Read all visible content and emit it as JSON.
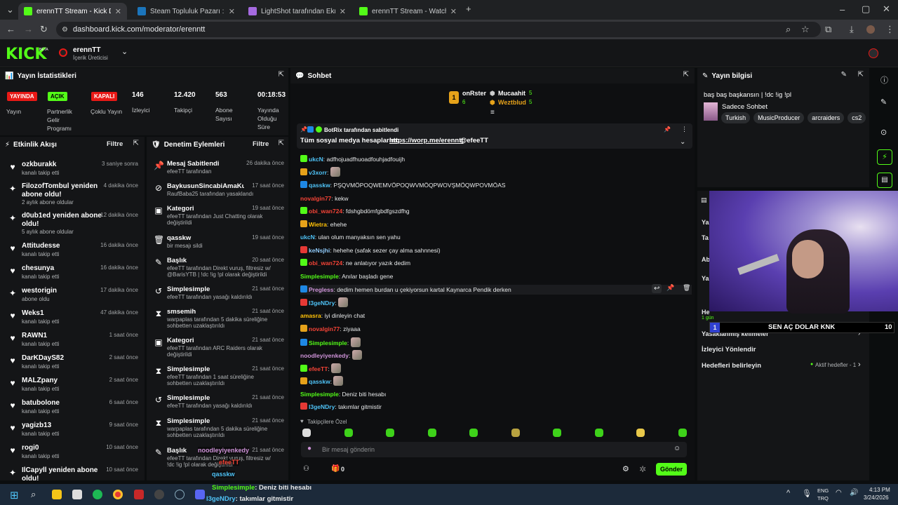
{
  "tabs": [
    {
      "title": "erennTT Stream - Kick Dashbo",
      "active": true,
      "color": "#53fc18"
    },
    {
      "title": "Steam Topluluk Pazarı :: Kul",
      "active": false,
      "color": "#1b75bb"
    },
    {
      "title": "LightShot tarafından Ekran Gö",
      "active": false,
      "color": "#a56ae0"
    },
    {
      "title": "erennTT Stream - Watch Live o",
      "active": false,
      "color": "#53fc18"
    }
  ],
  "url": "dashboard.kick.com/moderator/erenntt",
  "header": {
    "logo": "KICK",
    "beta": "BETA",
    "channel": "erennTT",
    "role": "İçerik Üreticisi"
  },
  "stats": {
    "title": "Yayın İstatistikleri",
    "badges": [
      {
        "badge": "YAYINDA",
        "label": "Yayın",
        "color": "#e91916"
      },
      {
        "badge": "AÇIK",
        "label": "Partnerlik Gelir Programı",
        "color": "#53fc18"
      },
      {
        "badge": "KAPALI",
        "label": "Çoklu Yayın",
        "color": "#e91916"
      }
    ],
    "numbers": [
      {
        "value": "146",
        "label": "İzleyici"
      },
      {
        "value": "12.420",
        "label": "Takipçi"
      },
      {
        "value": "563",
        "label": "Abone Sayısı"
      },
      {
        "value": "00:18:53",
        "label": "Yayında Olduğu Süre"
      }
    ]
  },
  "activity": {
    "title": "Etkinlik Akışı",
    "filter": "Filtre",
    "items": [
      {
        "name": "ozkburakk",
        "sub": "kanalı takip etti",
        "time": "3 saniye sonra",
        "icon": "♥"
      },
      {
        "name": "FilozofTombul yeniden abone oldu!",
        "sub": "2 aylık abone oldular",
        "time": "4 dakika önce",
        "icon": "✦"
      },
      {
        "name": "d0ub1ed yeniden abone oldu!",
        "sub": "5 aylık abone oldular",
        "time": "12 dakika önce",
        "icon": "✦"
      },
      {
        "name": "Attitudesse",
        "sub": "kanalı takip etti",
        "time": "16 dakika önce",
        "icon": "♥"
      },
      {
        "name": "chesunya",
        "sub": "kanalı takip etti",
        "time": "16 dakika önce",
        "icon": "♥"
      },
      {
        "name": "westorigin",
        "sub": "abone oldu",
        "time": "17 dakika önce",
        "icon": "✦"
      },
      {
        "name": "Weks1",
        "sub": "kanalı takip etti",
        "time": "47 dakika önce",
        "icon": "♥"
      },
      {
        "name": "RAWN1",
        "sub": "kanalı takip etti",
        "time": "1 saat önce",
        "icon": "♥"
      },
      {
        "name": "DarKDayS82",
        "sub": "kanalı takip etti",
        "time": "2 saat önce",
        "icon": "♥"
      },
      {
        "name": "MALZpany",
        "sub": "kanalı takip etti",
        "time": "2 saat önce",
        "icon": "♥"
      },
      {
        "name": "batubolone",
        "sub": "kanalı takip etti",
        "time": "6 saat önce",
        "icon": "♥"
      },
      {
        "name": "yagizb13",
        "sub": "kanalı takip etti",
        "time": "9 saat önce",
        "icon": "♥"
      },
      {
        "name": "rogi0",
        "sub": "kanalı takip etti",
        "time": "10 saat önce",
        "icon": "♥"
      },
      {
        "name": "IlCapyll yeniden abone oldu!",
        "sub": "",
        "time": "10 saat önce",
        "icon": "✦"
      }
    ]
  },
  "mod": {
    "title": "Denetim Eylemleri",
    "filter": "Filtre",
    "items": [
      {
        "name": "Mesaj Sabitlendi",
        "sub": "efeeTT tarafından",
        "time": "26 dakika önce",
        "icon": "📌"
      },
      {
        "name": "BaykusunSincabiAmaKurdish",
        "sub": "RaufBaba25 tarafından yasaklandı",
        "time": "17 saat önce",
        "icon": "⊘"
      },
      {
        "name": "Kategori",
        "sub": "efeeTT tarafından Just Chatting olarak değiştirildi",
        "time": "19 saat önce",
        "icon": "▣"
      },
      {
        "name": "qasskw",
        "sub": "bir mesajı sildi",
        "time": "19 saat önce",
        "icon": "🗑"
      },
      {
        "name": "Başlık",
        "sub": "efeeTT tarafından Direkt vuruş, filtresiz w/ @BarisYTB | !dc !ig !pl olarak değiştirildi",
        "time": "20 saat önce",
        "icon": "✎"
      },
      {
        "name": "Simplesimple",
        "sub": "efeeTT tarafından yasağı kaldırıldı",
        "time": "21 saat önce",
        "icon": "↺"
      },
      {
        "name": "smsemih",
        "sub": "warpaplas tarafından 5 dakika süreliğine sohbetten uzaklaştırıldı",
        "time": "21 saat önce",
        "icon": "⧗"
      },
      {
        "name": "Kategori",
        "sub": "efeeTT tarafından ARC Raiders olarak değiştirildi",
        "time": "21 saat önce",
        "icon": "▣"
      },
      {
        "name": "Simplesimple",
        "sub": "efeeTT tarafından 1 saat süreliğine sohbetten uzaklaştırıldı",
        "time": "21 saat önce",
        "icon": "⧗"
      },
      {
        "name": "Simplesimple",
        "sub": "efeeTT tarafından yasağı kaldırıldı",
        "time": "21 saat önce",
        "icon": "↺"
      },
      {
        "name": "Simplesimple",
        "sub": "warpaplas tarafından 5 dakika süreliğine sohbetten uzaklaştırıldı",
        "time": "21 saat önce",
        "icon": "⧗"
      },
      {
        "name": "Başlık",
        "sub": "efeeTT tarafından Direkt vuruş, filtresiz w/ !dc !ig !pl olarak değiştirildi",
        "time": "21 saat önce",
        "icon": "✎"
      }
    ]
  },
  "chat": {
    "title": "Sohbet",
    "top": [
      {
        "name": "onRster",
        "value": "6"
      },
      {
        "name": "Mucaahit",
        "value": "5"
      },
      {
        "name": "Weztblud",
        "value": "5"
      }
    ],
    "pinned_by": "BotRix tarafından sabitlendi",
    "pinned_text": "Tüm sosyal medya hesaplarım:",
    "pinned_link": "https://worp.me/erenntt",
    "pinned_tail": "@efeeTT",
    "messages": [
      {
        "user": "ukcN",
        "color": "#4fc3f7",
        "text": "adfhojuadfhuoadfouhjadfouijh"
      },
      {
        "user": "v3xorr",
        "color": "#4fc3f7",
        "text": ""
      },
      {
        "user": "qasskw",
        "color": "#4fc3f7",
        "text": "PŞQVMÖPOQWEMVÖPOQWVMÖQPWOVŞMÖQWPOVMÖAS"
      },
      {
        "user": "novalgin77",
        "color": "#f44336",
        "text": "kekw"
      },
      {
        "user": "obi_wan724",
        "color": "#f44336",
        "text": "fdshgbdömfgbdfgszdfhg"
      },
      {
        "user": "Wietra",
        "color": "#ffc107",
        "text": "ehehe"
      },
      {
        "user": "ukcN",
        "color": "#4fc3f7",
        "text": "ulan olum manyaksın sen yahu"
      },
      {
        "user": "keNsjhi",
        "color": "#90caf9",
        "text": "hehehe (safak sezer çay alma sahnnesi)"
      },
      {
        "user": "obi_wan724",
        "color": "#f44336",
        "text": "ne anlatıyor yazık dedim"
      },
      {
        "user": "Simplesimple",
        "color": "#53fc18",
        "text": "Anılar başladı gene"
      },
      {
        "user": "Pregless",
        "color": "#ce93d8",
        "text": "dedim hemen burdan u çekiyorsun kartal Kaynarca Pendik derken"
      },
      {
        "user": "l3geNDry",
        "color": "#4fc3f7",
        "text": ""
      },
      {
        "user": "amasra",
        "color": "#ffc107",
        "text": "iyi dinleyin chat"
      },
      {
        "user": "novalgin77",
        "color": "#f44336",
        "text": "ziyaaa"
      },
      {
        "user": "Simplesimple",
        "color": "#53fc18",
        "text": ""
      },
      {
        "user": "noodleyiyenkedy",
        "color": "#ce93d8",
        "text": ""
      },
      {
        "user": "efeeTT",
        "color": "#f44336",
        "text": ""
      },
      {
        "user": "qasskw",
        "color": "#4fc3f7",
        "text": ""
      },
      {
        "user": "Simplesimple",
        "color": "#53fc18",
        "text": "Deniz biti hesabı"
      },
      {
        "user": "l3geNDry",
        "color": "#4fc3f7",
        "text": "takımlar gitmistir"
      }
    ],
    "followers_only": "Takipçilere Özel",
    "placeholder": "Bir mesaj gönderin",
    "send": "Gönder",
    "count": "0"
  },
  "info": {
    "title": "Yayın bilgisi",
    "stream_title": "baş baş başkansın | !dc !ig !pl",
    "category": "Sadece Sohbet",
    "tags": [
      "Turkish",
      "MusicProducer",
      "arcraiders",
      "cs2"
    ],
    "poll_num": "1",
    "poll_text": "SEN AÇ DOLAR KNK",
    "poll_count": "10",
    "rows": [
      "İzleyici Yönlendir",
      "Hedefleri belirleyin"
    ],
    "goals": "Aktif hedefler - 1",
    "partial": [
      "Ya",
      "Ta",
      "Ab",
      "Ya",
      "He"
    ],
    "partial2": "Yasaklanmış kelimeler",
    "partial3": "1 gün"
  },
  "overlay": {
    "l1_user": "noodleyiyenkedy",
    "l2_user": "efeeTT",
    "l3_user": "qasskw",
    "l4_user": "Simplesimple",
    "l4_text": ": Deniz biti hesabı",
    "l5_user": "l3geNDry",
    "l5_text": ": takımlar gitmistir"
  },
  "taskbar": {
    "lang1": "ENG",
    "lang2": "TRQ",
    "time": "4:13 PM",
    "date": "3/24/2026"
  }
}
